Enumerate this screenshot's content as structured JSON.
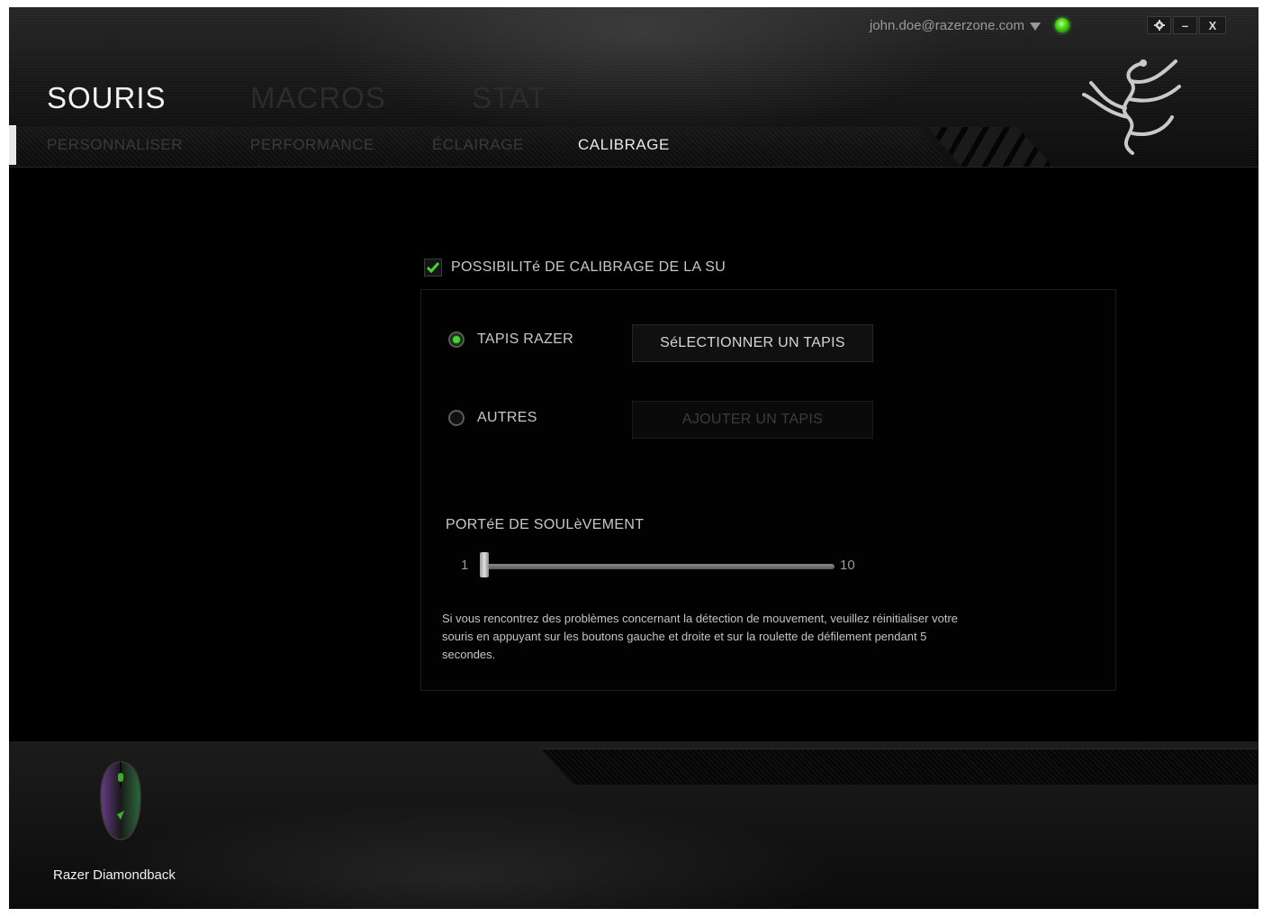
{
  "header": {
    "account_email": "john.doe@razerzone.com",
    "window_controls": {
      "settings_icon": "gear-icon",
      "minimize_label": "–",
      "close_label": "X"
    }
  },
  "main_tabs": [
    {
      "label": "SOURIS",
      "active": true
    },
    {
      "label": "MACROS",
      "active": false
    },
    {
      "label": "STAT",
      "active": false
    }
  ],
  "sub_tabs": [
    {
      "label": "PERSONNALISER",
      "active": false
    },
    {
      "label": "PERFORMANCE",
      "active": false
    },
    {
      "label": "ÉCLAIRAGE",
      "active": false
    },
    {
      "label": "CALIBRAGE",
      "active": true
    }
  ],
  "calibration": {
    "enable_label": "POSSIBILITé DE CALIBRAGE DE LA SU",
    "enabled": true,
    "options": [
      {
        "label": "TAPIS RAZER",
        "selected": true,
        "button_label": "SéLECTIONNER UN TAPIS",
        "button_enabled": true
      },
      {
        "label": "AUTRES",
        "selected": false,
        "button_label": "AJOUTER UN TAPIS",
        "button_enabled": false
      }
    ],
    "lift_off": {
      "label": "PORTéE DE SOULèVEMENT",
      "min": "1",
      "max": "10",
      "value": 1
    },
    "help_text": "Si vous rencontrez des problèmes concernant la détection de mouvement, veuillez réinitialiser votre souris en appuyant sur les boutons gauche et droite et sur la roulette de défilement pendant 5 secondes."
  },
  "device": {
    "name": "Razer Diamondback"
  },
  "colors": {
    "accent": "#44d62c",
    "background": "#000000",
    "text": "#c8c8c8"
  }
}
